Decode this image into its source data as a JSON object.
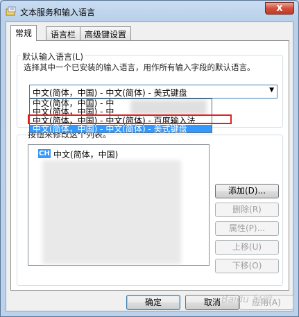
{
  "window": {
    "title": "文本服务和输入语言",
    "close_label": "X"
  },
  "tabs": [
    {
      "label": "常规",
      "active": true
    },
    {
      "label": "语言栏",
      "active": false
    },
    {
      "label": "高级键设置",
      "active": false
    }
  ],
  "default_input": {
    "group_label": "默认输入语言(L)",
    "description": "选择其中一个已安装的输入语言，用作所有输入字段的默认语言。",
    "selected_value": "中文(简体，中国) - 中文(简体) - 美式键盘",
    "dropdown_options": [
      "中文(简体，中国) - 中",
      "中文(简体，中国) - 中",
      "中文(简体，中国) - 中文(简体) - 百度输入法",
      "中文(简体，中国) - 中文(简体) - 美式键盘"
    ]
  },
  "installed": {
    "list_label": "按钮来修改这个列表。",
    "language_tag": "CH",
    "language_name": "中文(简体，中国)"
  },
  "side_buttons": {
    "add": "添加(D)...",
    "remove": "删除(R)",
    "properties": "属性(P)...",
    "move_up": "上移(U)",
    "move_down": "下移(O)"
  },
  "bottom_buttons": {
    "ok": "确定",
    "cancel": "取消",
    "apply": "应用(A)"
  },
  "watermark": "Baidu 经验",
  "colors": {
    "selection": "#3399ff",
    "highlight_box": "#e0201f"
  }
}
